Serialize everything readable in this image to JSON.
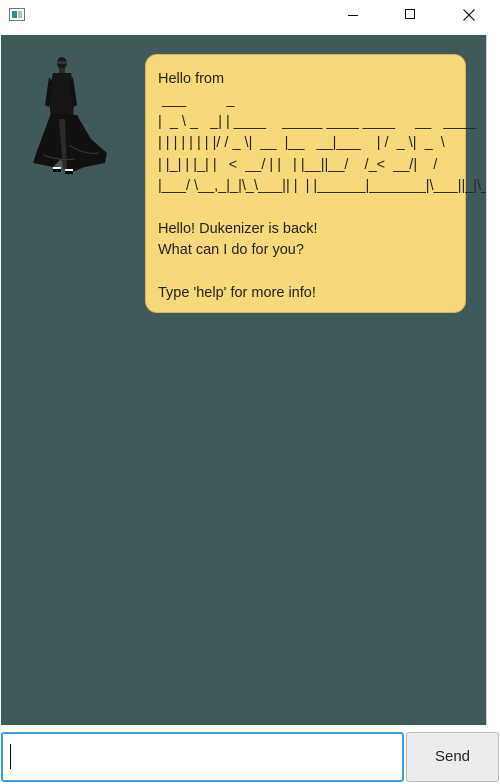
{
  "window": {
    "minimize_icon": "minimize-icon",
    "maximize_icon": "maximize-icon",
    "close_icon": "close-icon"
  },
  "chat": {
    "background_color": "#405a5b",
    "bubble_color": "#f7d97c",
    "messages": [
      {
        "sender": "duke",
        "avatar": "man-in-black-coat-icon",
        "text": "Hello from\n ___          _\n|  _ \\ _   _| | ____    _____ ____ ____     __   ____\n| | | | | | | |/ / _ \\|  __  |__   __|___    | /  _ \\|  _  \\\n| |_| | |_| |   <  __/ | |   | |__||__/    /_<  __/|    /\n|___/ \\__,_|_|\\_\\___|| |  | |______|_______|\\___||_|\\_\\\n\nHello! Dukenizer is back!\nWhat can I do for you?\n\nType 'help' for more info!"
      }
    ]
  },
  "input": {
    "value": "",
    "placeholder": ""
  },
  "send_button": {
    "label": "Send"
  }
}
